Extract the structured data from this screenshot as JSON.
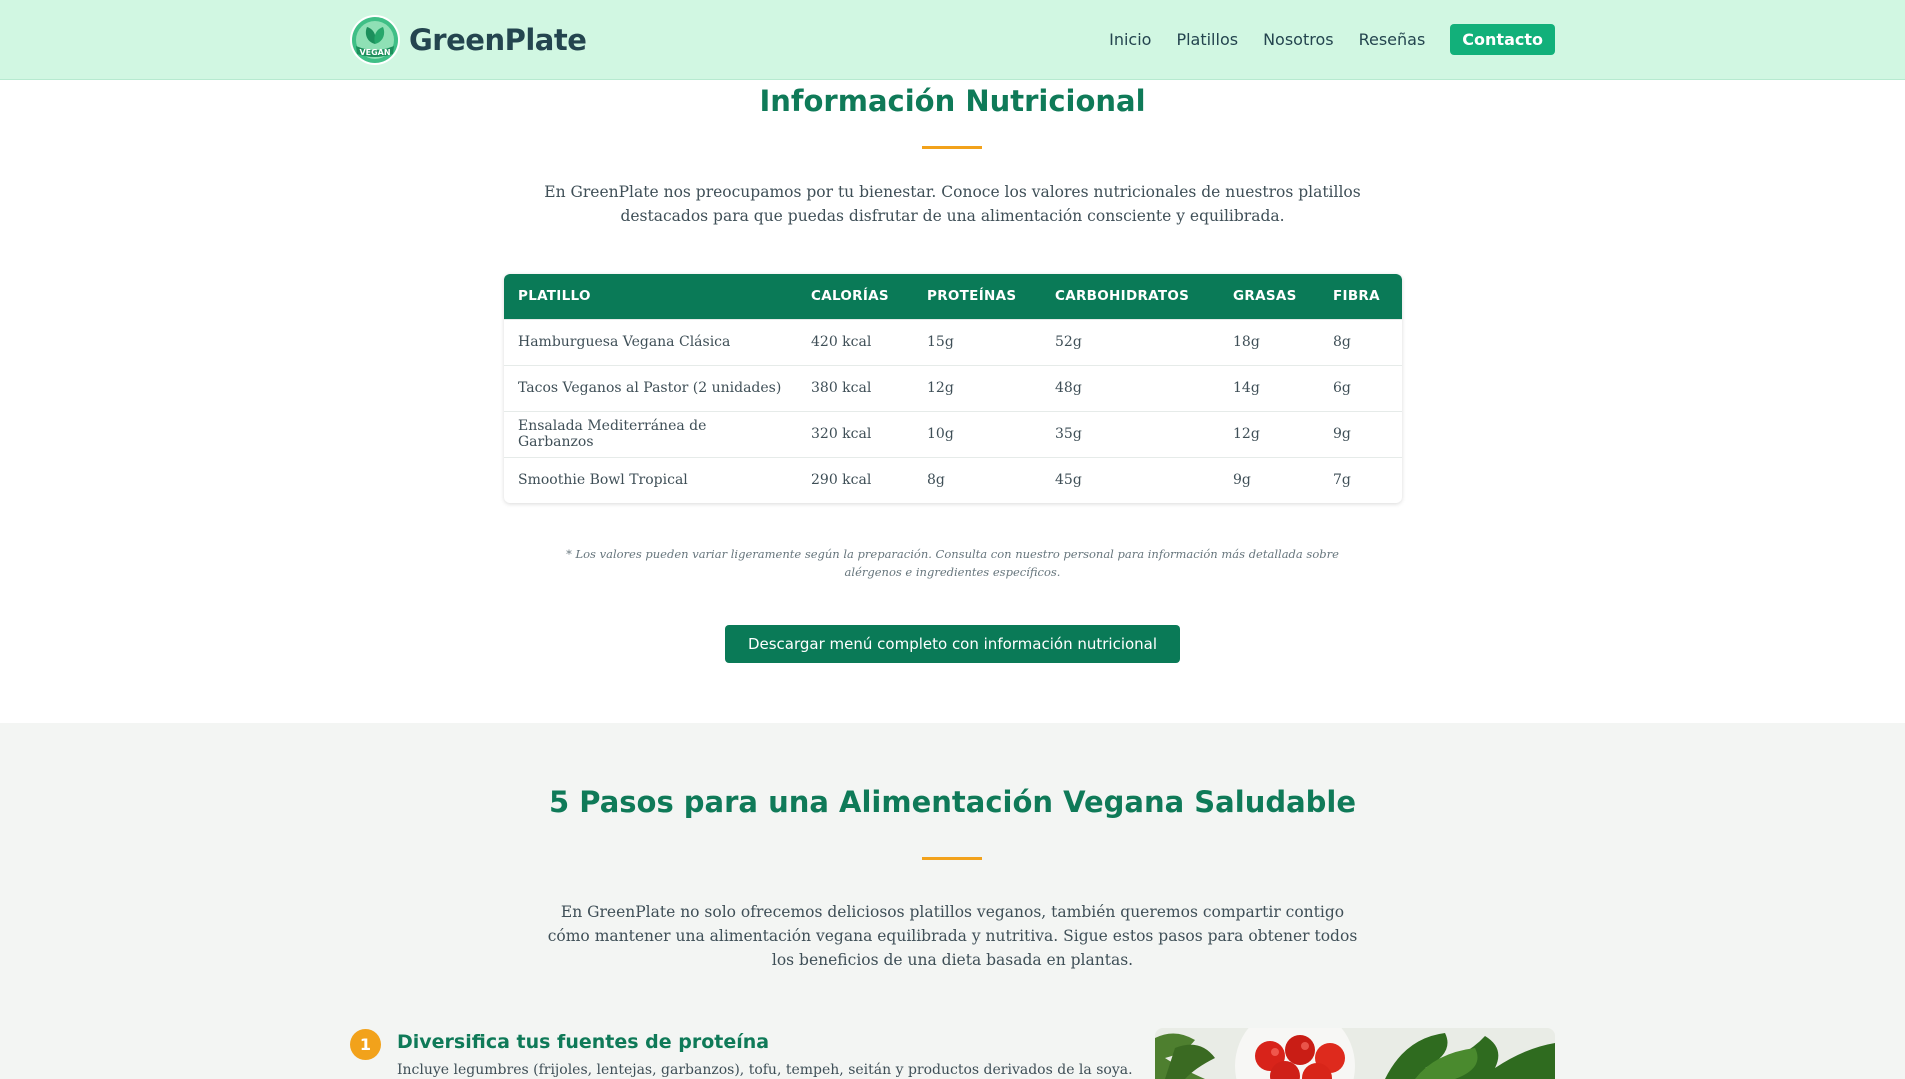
{
  "header": {
    "brand": "GreenPlate",
    "logo_badge_text": "VEGAN",
    "nav": [
      "Inicio",
      "Platillos",
      "Nosotros",
      "Reseñas"
    ],
    "cta": "Contacto"
  },
  "nutrition": {
    "title": "Información Nutricional",
    "intro": "En GreenPlate nos preocupamos por tu bienestar. Conoce los valores nutricionales de nuestros platillos destacados para que puedas disfrutar de una alimentación consciente y equilibrada.",
    "columns": [
      "PLATILLO",
      "CALORÍAS",
      "PROTEÍNAS",
      "CARBOHIDRATOS",
      "GRASAS",
      "FIBRA"
    ],
    "rows": [
      [
        "Hamburguesa Vegana Clásica",
        "420 kcal",
        "15g",
        "52g",
        "18g",
        "8g"
      ],
      [
        "Tacos Veganos al Pastor (2 unidades)",
        "380 kcal",
        "12g",
        "48g",
        "14g",
        "6g"
      ],
      [
        "Ensalada Mediterránea de Garbanzos",
        "320 kcal",
        "10g",
        "35g",
        "12g",
        "9g"
      ],
      [
        "Smoothie Bowl Tropical",
        "290 kcal",
        "8g",
        "45g",
        "9g",
        "7g"
      ]
    ],
    "note": "* Los valores pueden variar ligeramente según la preparación. Consulta con nuestro personal para información más detallada sobre alérgenos e ingredientes específicos.",
    "download_button": "Descargar menú completo con información nutricional"
  },
  "steps": {
    "title": "5 Pasos para una Alimentación Vegana Saludable",
    "intro": "En GreenPlate no solo ofrecemos deliciosos platillos veganos, también queremos compartir contigo cómo mantener una alimentación vegana equilibrada y nutritiva. Sigue estos pasos para obtener todos los beneficios de una dieta basada en plantas.",
    "items": [
      {
        "number": "1",
        "title": "Diversifica tus fuentes de proteína",
        "text": "Incluye legumbres (frijoles, lentejas, garbanzos), tofu, tempeh, seitán y productos derivados de la soya."
      }
    ]
  },
  "colors": {
    "header_bg": "#d1f7e2",
    "primary": "#0a7a57",
    "accent": "#f2a21b",
    "cta": "#12b07a"
  }
}
